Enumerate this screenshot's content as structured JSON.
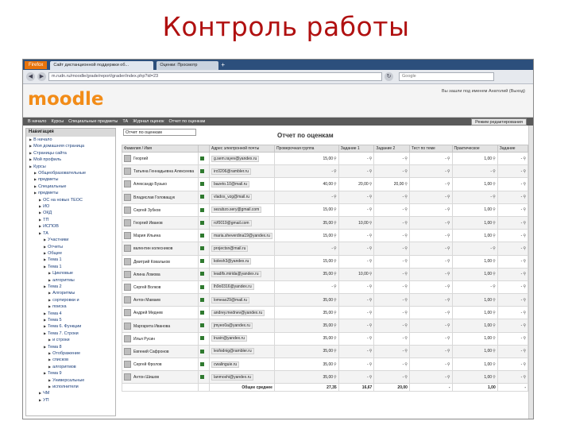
{
  "slide": {
    "title": "Контроль работы"
  },
  "browser": {
    "menu_button": "Firefox",
    "tabs": [
      "Сайт дистанционной поддержки об...",
      "Оценки: Просмотр"
    ],
    "url": "m.rudn.ru/moodle/grade/report/grader/index.php?id=23",
    "search_placeholder": "Google"
  },
  "moodle": {
    "logo_main": "moodle",
    "login_info": "Вы зашли под именем Анатолий (Выход)",
    "breadcrumbs": [
      "В начало",
      "Курсы",
      "Специальные предметы",
      "ТА",
      "Журнал оценок",
      "Отчет по оценкам"
    ],
    "edit_button": "Режим редактирования"
  },
  "navigation": {
    "header": "Навигация",
    "items": [
      {
        "label": "В начало",
        "level": 0
      },
      {
        "label": "Моя домашняя страница",
        "level": 0
      },
      {
        "label": "Страницы сайта",
        "level": 0
      },
      {
        "label": "Мой профиль",
        "level": 0
      },
      {
        "label": "Курсы",
        "level": 0
      },
      {
        "label": "Общеобразовательные",
        "level": 1
      },
      {
        "label": "предметы",
        "level": 1
      },
      {
        "label": "Специальные",
        "level": 1
      },
      {
        "label": "предметы",
        "level": 1
      },
      {
        "label": "ОС на новых ТЕОС",
        "level": 2
      },
      {
        "label": "ИО",
        "level": 2
      },
      {
        "label": "ОКД",
        "level": 2
      },
      {
        "label": "ТП",
        "level": 2
      },
      {
        "label": "ИСПОВ",
        "level": 2
      },
      {
        "label": "ТА",
        "level": 2
      },
      {
        "label": "Участники",
        "level": 3
      },
      {
        "label": "Отчеты",
        "level": 3
      },
      {
        "label": "Общее",
        "level": 3
      },
      {
        "label": "Тема 1",
        "level": 3
      },
      {
        "label": "Тема 1",
        "level": 3
      },
      {
        "label": "Цикловые",
        "level": 4
      },
      {
        "label": "алгоритмы",
        "level": 4
      },
      {
        "label": "Тема 2",
        "level": 3
      },
      {
        "label": "Алгоритмы",
        "level": 4
      },
      {
        "label": "сортировки и",
        "level": 4
      },
      {
        "label": "поиска",
        "level": 4
      },
      {
        "label": "Тема 4",
        "level": 3
      },
      {
        "label": "Тема 5",
        "level": 3
      },
      {
        "label": "Тема 6. Функции",
        "level": 3
      },
      {
        "label": "Тема 7. Строки",
        "level": 3
      },
      {
        "label": "и строки",
        "level": 4
      },
      {
        "label": "Тема 8",
        "level": 3
      },
      {
        "label": "Отображение",
        "level": 4
      },
      {
        "label": "списков",
        "level": 4
      },
      {
        "label": "алгоритмов",
        "level": 4
      },
      {
        "label": "Тема 9",
        "level": 3
      },
      {
        "label": "Универсальные",
        "level": 4
      },
      {
        "label": "исполнители",
        "level": 4
      },
      {
        "label": "ЧМ",
        "level": 2
      },
      {
        "label": "УП",
        "level": 2
      }
    ]
  },
  "report": {
    "select_value": "Отчет по оценкам",
    "title": "Отчет по оценкам",
    "columns": [
      "Фамилия / Имя",
      "Адрес электронной почты",
      "Проверочная группа",
      "Задание 1",
      "Задание 2",
      "Тест по теме",
      "Практическое",
      "Задание"
    ],
    "rows": [
      {
        "name": "Георгий",
        "email": "g.sem.rayev@yandex.ru",
        "v": [
          "15,00",
          "-",
          "-",
          "-",
          "1,00",
          "-"
        ]
      },
      {
        "name": "Татьяна Геннадьевна Алексеева",
        "email": "irc0206@rambler.ru",
        "v": [
          "-",
          "-",
          "-",
          "-",
          "-",
          "-"
        ]
      },
      {
        "name": "Александр Бузько",
        "email": "bazeto.10@mail.ru",
        "v": [
          "40,00",
          "20,00",
          "20,00",
          "-",
          "1,00",
          "-"
        ]
      },
      {
        "name": "Владислав Головащук",
        "email": "vlados_vzg@mail.ru",
        "v": [
          "-",
          "-",
          "-",
          "-",
          "-",
          "-"
        ]
      },
      {
        "name": "Сергей Зубков",
        "email": "sezubzo.sery@gmail.com",
        "v": [
          "15,00",
          "-",
          "-",
          "-",
          "1,00",
          "-"
        ]
      },
      {
        "name": "Георгий Иванов",
        "email": "rcf0019@gmail.com",
        "v": [
          "35,00",
          "10,00",
          "-",
          "-",
          "1,00",
          "-"
        ]
      },
      {
        "name": "Мария Ильина",
        "email": "maria.sheverdina19@yandex.ru",
        "v": [
          "15,00",
          "-",
          "-",
          "-",
          "1,00",
          "-"
        ]
      },
      {
        "name": "валентин колесников",
        "email": "projectsn@mail.ru",
        "v": [
          "-",
          "-",
          "-",
          "-",
          "-",
          "-"
        ]
      },
      {
        "name": "Дмитрий Ковальков",
        "email": "kolesh3@yandex.ru",
        "v": [
          "15,00",
          "-",
          "-",
          "-",
          "1,00",
          "-"
        ]
      },
      {
        "name": "Алина Ломова",
        "email": "leadifs.mirida@yandex.ru",
        "v": [
          "35,00",
          "10,00",
          "-",
          "-",
          "1,00",
          "-"
        ]
      },
      {
        "name": "Сергей Волков",
        "email": "lh9o0316@yandex.ru",
        "v": [
          "-",
          "-",
          "-",
          "-",
          "-",
          "-"
        ]
      },
      {
        "name": "Антон Мамаев",
        "email": "lomeao29@mail.ru",
        "v": [
          "35,00",
          "-",
          "-",
          "-",
          "1,00",
          "-"
        ]
      },
      {
        "name": "Андрей Меднев",
        "email": "andrey.mednev@yandex.ru",
        "v": [
          "35,00",
          "-",
          "-",
          "-",
          "1,00",
          "-"
        ]
      },
      {
        "name": "Маргарита Иванова",
        "email": "jmyeo0a@yandex.ru",
        "v": [
          "35,00",
          "-",
          "-",
          "-",
          "1,00",
          "-"
        ]
      },
      {
        "name": "Илья Русин",
        "email": "lrusin@yandex.ru",
        "v": [
          "35,00",
          "-",
          "-",
          "-",
          "1,00",
          "-"
        ]
      },
      {
        "name": "Евгений Сафронов",
        "email": "lesfodnig@rambler.ru",
        "v": [
          "35,00",
          "-",
          "-",
          "-",
          "1,00",
          "-"
        ]
      },
      {
        "name": "Сергей Фролов",
        "email": "cwalinguie.ru",
        "v": [
          "35,00",
          "-",
          "-",
          "-",
          "1,00",
          "-"
        ]
      },
      {
        "name": "Антон Шишов",
        "email": "lanmoshi@yandex.ru",
        "v": [
          "35,00",
          "-",
          "-",
          "-",
          "1,00",
          "-"
        ]
      }
    ],
    "avg_label": "Общее среднее",
    "avg_values": [
      "27,35",
      "16,67",
      "20,00",
      "-",
      "1,00",
      "-"
    ]
  }
}
